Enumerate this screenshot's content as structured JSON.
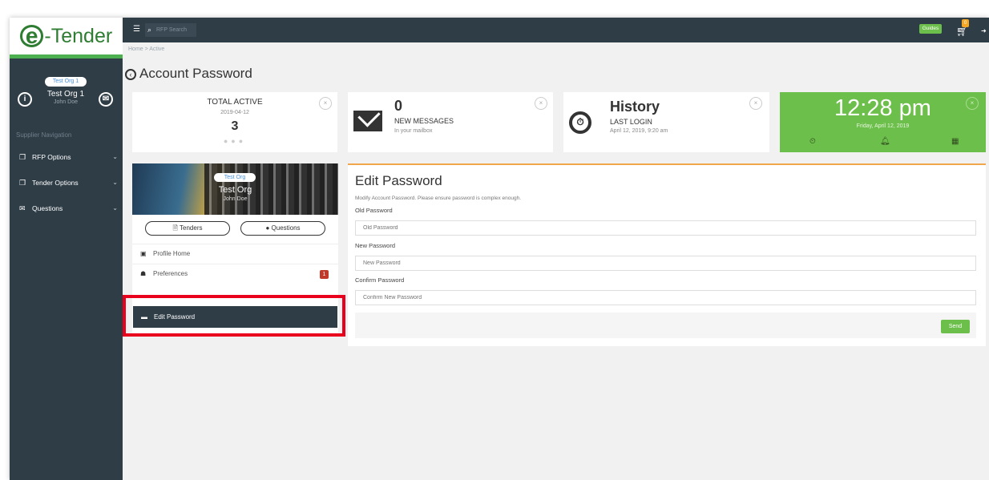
{
  "app": {
    "logo_e": "e",
    "logo_text": "-Tender"
  },
  "topbar": {
    "search_placeholder": "RFP Search",
    "guides_label": "Guides",
    "cart_count": "0"
  },
  "sidebar": {
    "avatar_alt": "Test Org 1",
    "org_name": "Test Org 1",
    "user_name": "John Doe",
    "nav_title": "Supplier Navigation",
    "items": [
      {
        "label": "RFP Options"
      },
      {
        "label": "Tender Options"
      },
      {
        "label": "Questions"
      }
    ]
  },
  "breadcrumb": "Home  >  Active",
  "page_title": "Account Password",
  "cards": {
    "total_active": {
      "title": "TOTAL ACTIVE",
      "date": "2019-04-12",
      "count": "3"
    },
    "messages": {
      "count": "0",
      "label": "NEW MESSAGES",
      "sub": "In your mailbox"
    },
    "history": {
      "title": "History",
      "label": "LAST LOGIN",
      "sub": "April 12, 2019, 9:20 am"
    },
    "clock": {
      "time": "12:28 pm",
      "date": "Friday, April 12, 2019"
    }
  },
  "profile": {
    "avatar_alt": "Test Org",
    "org_name": "Test Org",
    "user_name": "John Doe",
    "tenders_label": "Tenders",
    "questions_label": "Questions",
    "menu": [
      {
        "label": "Profile Home"
      },
      {
        "label": "Preferences",
        "badge": "1"
      },
      {
        "label": "Edit Password"
      }
    ]
  },
  "edit_password": {
    "title": "Edit Password",
    "description": "Modify Account Password. Please ensure password is complex enough.",
    "old_label": "Old Password",
    "old_placeholder": "Old Password",
    "new_label": "New Password",
    "new_placeholder": "New Password",
    "confirm_label": "Confirm Password",
    "confirm_placeholder": "Confirm New Password",
    "send_label": "Send"
  },
  "colors": {
    "sidebar": "#2f3d47",
    "accent_green": "#6cbf4a",
    "highlight": "#e8001c",
    "badge_red": "#c0392b"
  }
}
